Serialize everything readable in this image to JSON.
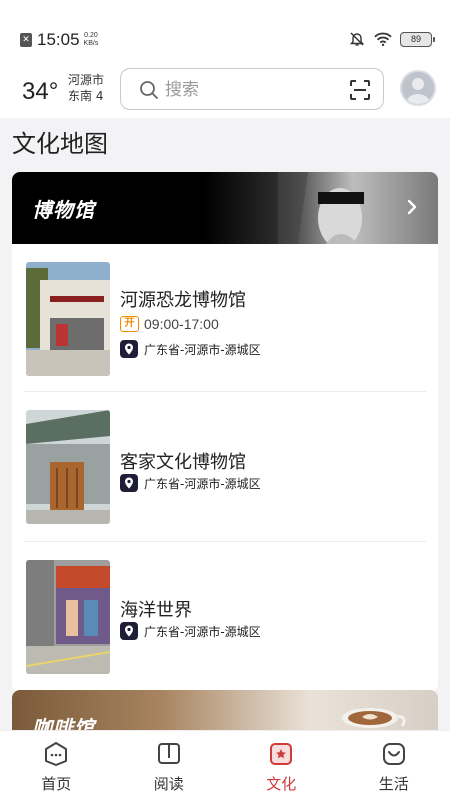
{
  "status_bar": {
    "time": "15:05",
    "net_speed_value": "0.20",
    "net_speed_unit": "KB/s",
    "battery": "89"
  },
  "header": {
    "temperature": "34°",
    "city": "河源市",
    "wind": "东南 4",
    "search_placeholder": "搜索"
  },
  "page": {
    "title": "文化地图"
  },
  "category": {
    "title": "博物馆",
    "items": [
      {
        "name": "河源恐龙博物馆",
        "open_badge": "开",
        "hours": "09:00-17:00",
        "address": "广东省-河源市-源城区"
      },
      {
        "name": "客家文化博物馆",
        "address": "广东省-河源市-源城区"
      },
      {
        "name": "海洋世界",
        "address": "广东省-河源市-源城区"
      }
    ]
  },
  "next_category": {
    "title": "咖啡馆"
  },
  "tabbar": {
    "tabs": [
      {
        "label": "首页",
        "icon": "home-icon"
      },
      {
        "label": "阅读",
        "icon": "book-icon"
      },
      {
        "label": "文化",
        "icon": "culture-icon",
        "active": true
      },
      {
        "label": "生活",
        "icon": "life-icon"
      }
    ]
  },
  "colors": {
    "accent": "#d23b3b",
    "open_badge": "#f08a00",
    "pin_bg": "#1e1e36"
  }
}
